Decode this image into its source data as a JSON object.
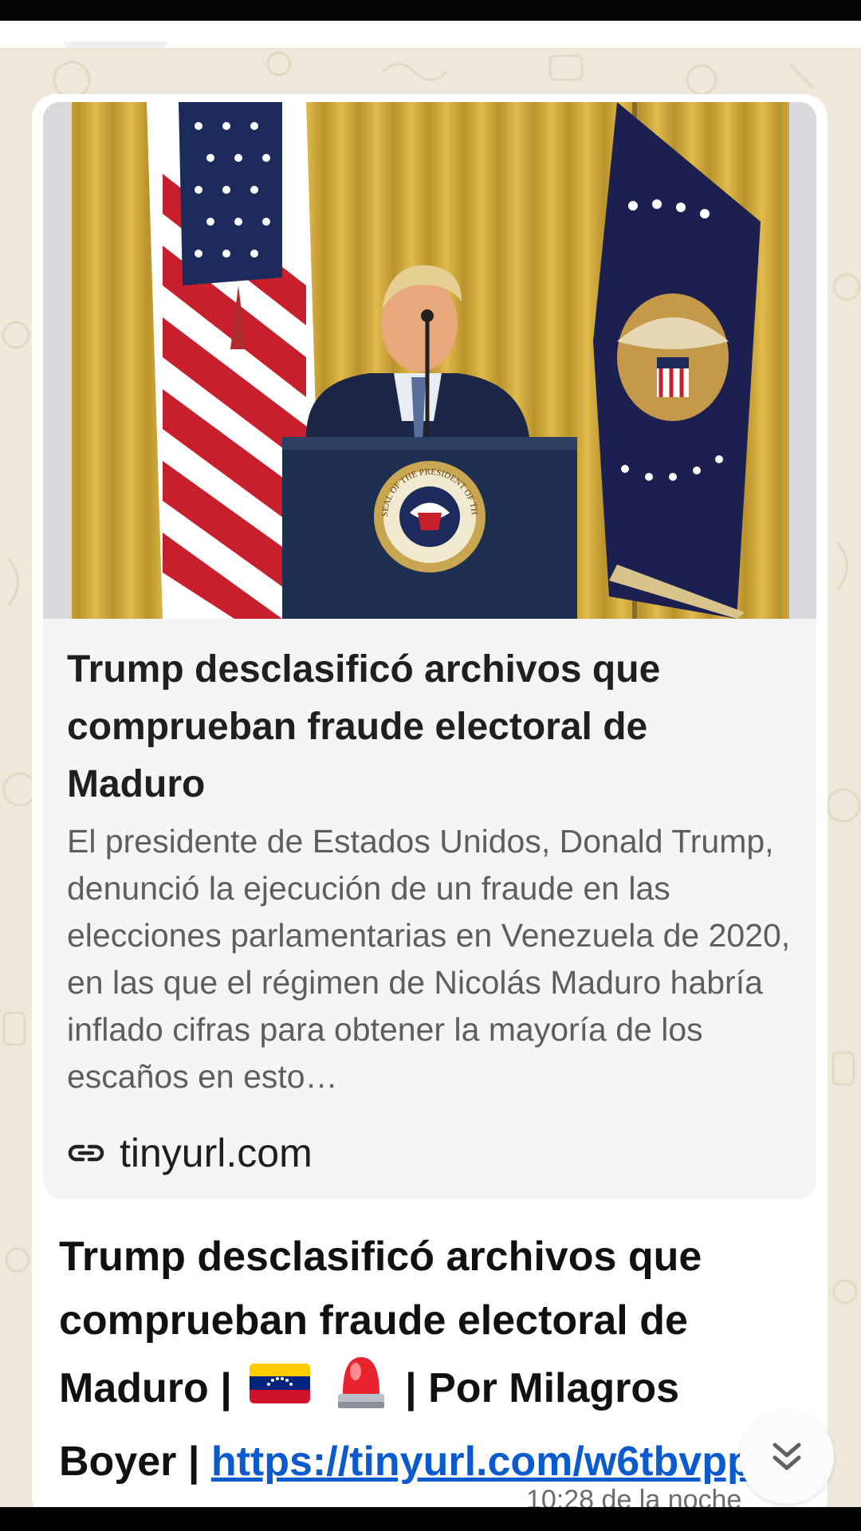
{
  "preview": {
    "title": "Trump desclasificó archivos que comprueban fraude electoral de Maduro",
    "description": "El presidente de Estados Unidos, Donald Trump, denunció la ejecución de un fraude en las elecciones parlamentarias en Venezuela de 2020, en las que el régimen de Nicolás Maduro habría inflado cifras para obtener la mayoría de los escaños en esto…",
    "domain": "tinyurl.com",
    "image_alt": "Donald Trump speaking at a podium with the presidential seal, flags behind",
    "seal_text": "SEAL OF THE PRESIDENT OF THE UNITED STATES"
  },
  "message": {
    "text_part1": "Trump desclasificó archivos que comprueban fraude electoral de Maduro | ",
    "emoji_flag": "venezuela-flag-emoji",
    "emoji_siren": "police-light-emoji",
    "text_part2": " | Por Milagros Boyer | ",
    "link": "https://tinyurl.com/w6tbvpp2",
    "timestamp": "10:28 de la noche"
  },
  "icons": {
    "link": "link-icon",
    "scroll_down": "double-chevron-down-icon"
  },
  "colors": {
    "wallpaper": "#efe7d9",
    "bubble": "#ffffff",
    "preview_card": "#f6f5f3",
    "link": "#0b5bcf",
    "curtain": "#d4a732"
  }
}
